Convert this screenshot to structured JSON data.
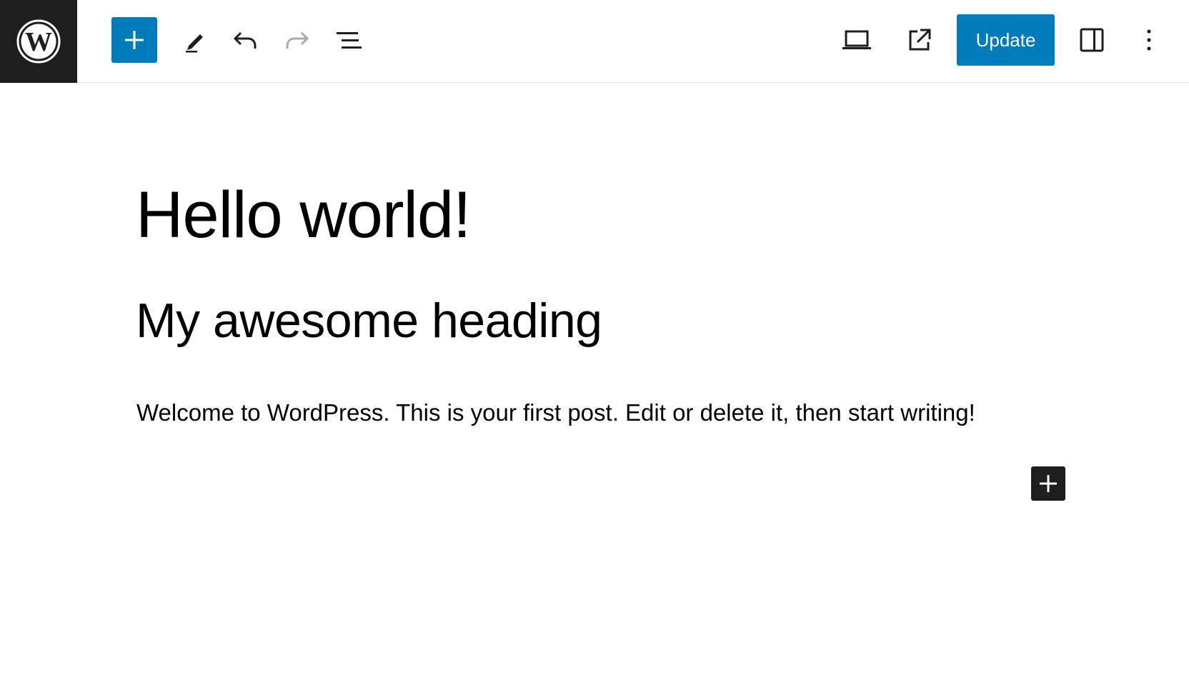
{
  "toolbar": {
    "logo_icon": "wordpress-logo-icon",
    "inserter_icon": "plus-icon",
    "tools_icon": "pencil-icon",
    "undo_icon": "undo-icon",
    "redo_icon": "redo-icon",
    "list_view_icon": "list-view-icon",
    "preview_icon": "laptop-icon",
    "view_post_icon": "external-link-icon",
    "update_label": "Update",
    "settings_icon": "sidebar-panel-icon",
    "options_icon": "more-vertical-icon"
  },
  "content": {
    "title": "Hello world!",
    "heading": "My awesome heading",
    "paragraph": "Welcome to WordPress. This is your first post. Edit or delete it, then start writing!",
    "appender_icon": "plus-icon"
  },
  "colors": {
    "accent": "#007cba",
    "dark": "#1e1e1e",
    "disabled": "#aaaaaa"
  }
}
